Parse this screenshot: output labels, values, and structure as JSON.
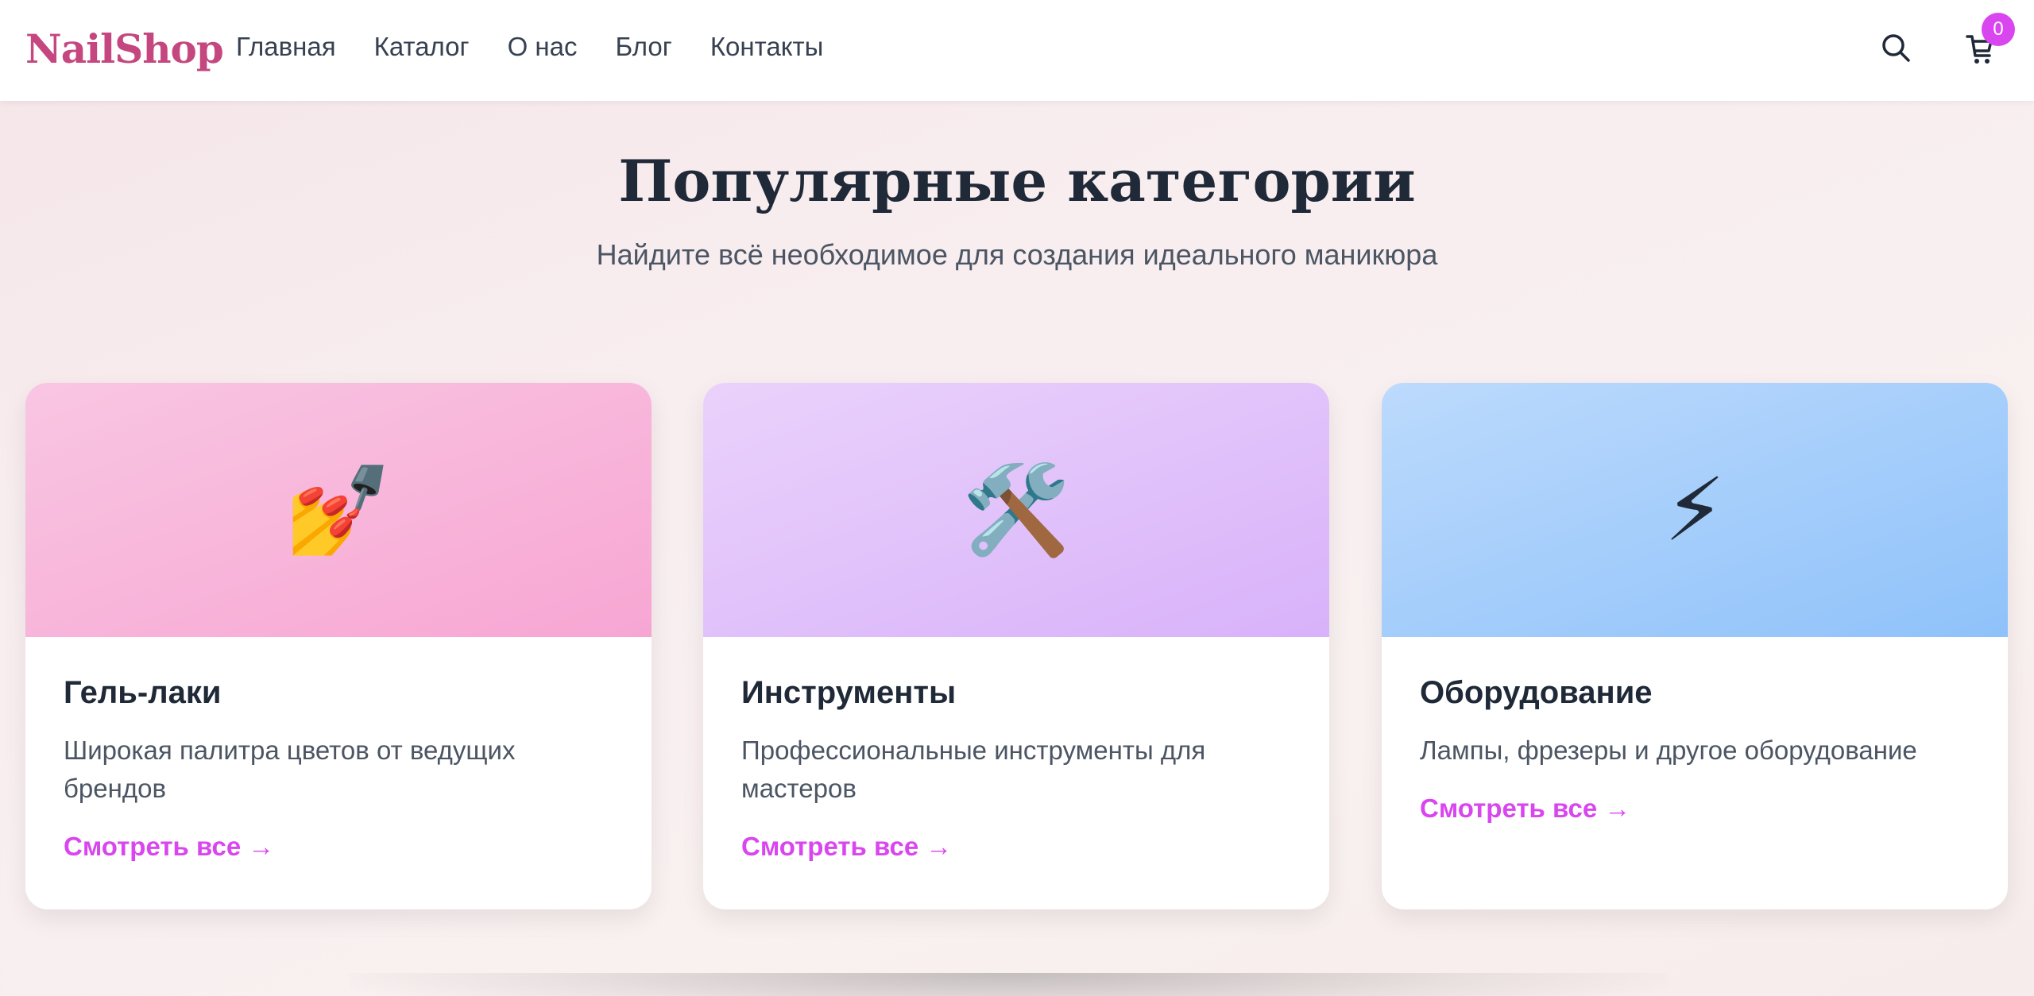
{
  "header": {
    "logo": "NailShop",
    "nav": [
      "Главная",
      "Каталог",
      "О нас",
      "Блог",
      "Контакты"
    ],
    "cart_count": "0"
  },
  "hero": {
    "title": "Популярные категории",
    "subtitle": "Найдите всё необходимое для создания идеального маникюра"
  },
  "categories": [
    {
      "emoji": "💅",
      "title": "Гель-лаки",
      "description": "Широкая палитра цветов от ведущих брендов",
      "link": "Смотреть все →",
      "gradient_start": "#f9c6e2",
      "gradient_end": "#f7a6d3"
    },
    {
      "emoji": "🛠️",
      "title": "Инструменты",
      "description": "Профессиональные инструменты для мастеров",
      "link": "Смотреть все →",
      "gradient_start": "#ead2fb",
      "gradient_end": "#d8b2fa"
    },
    {
      "emoji": "⚡",
      "title": "Оборудование",
      "description": "Лампы, фрезеры и другое оборудование",
      "link": "Смотреть все →",
      "gradient_start": "#bcdafc",
      "gradient_end": "#8fc2fa"
    }
  ],
  "colors": {
    "brand": "#c4477f",
    "accent": "#d946ef"
  }
}
